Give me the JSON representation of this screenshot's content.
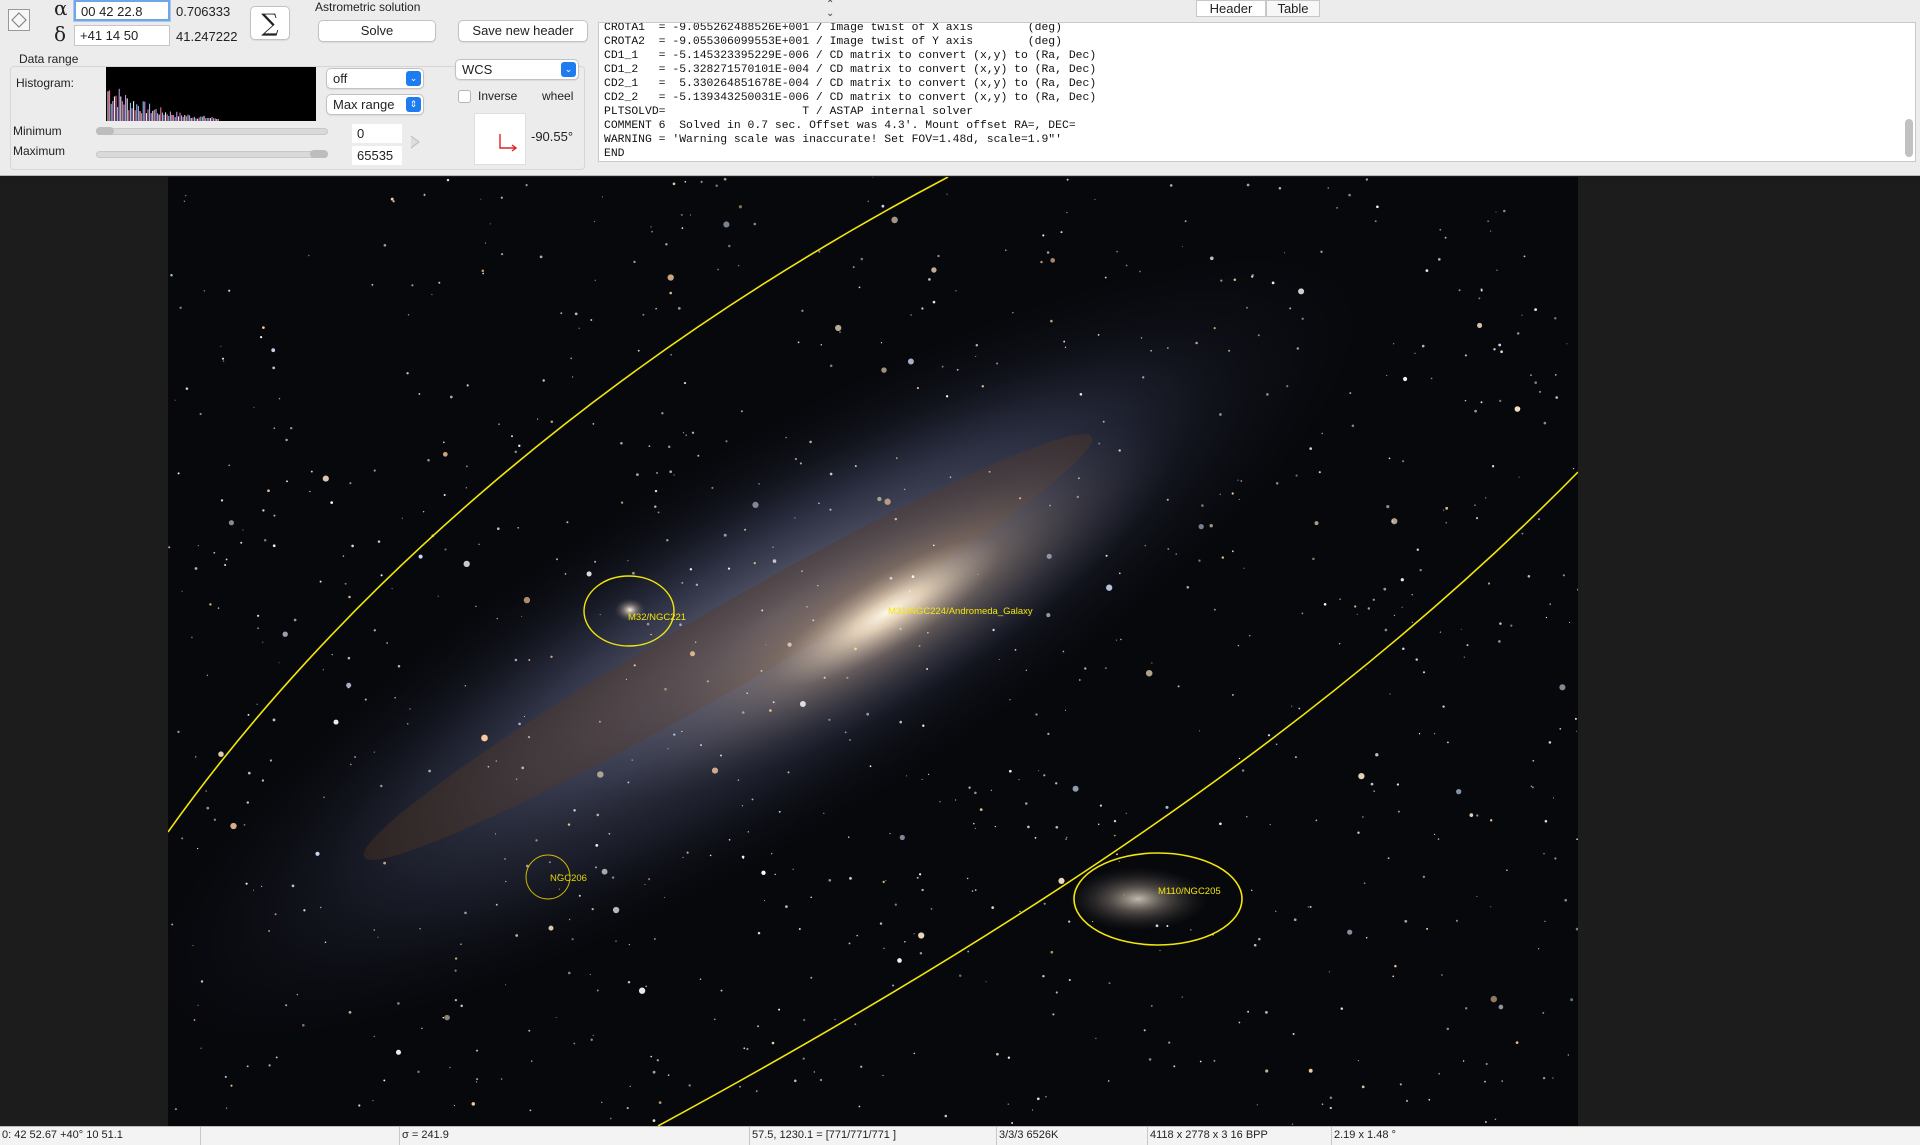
{
  "coords": {
    "alpha_symbol": "α",
    "delta_symbol": "δ",
    "ra_value": "00 42 22.8",
    "ra_decimal": "0.706333",
    "dec_value": "+41 14 50",
    "dec_decimal": "41.247222",
    "sigma_label": "∑"
  },
  "astrometric": {
    "title": "Astrometric solution",
    "solve_label": "Solve",
    "save_header_label": "Save new header"
  },
  "data_range": {
    "title": "Data range",
    "histogram_label": "Histogram:",
    "stretch_select": "off",
    "range_select": "Max range",
    "minimum_label": "Minimum",
    "maximum_label": "Maximum",
    "min_value": "0",
    "max_value": "65535",
    "min_slider_level": 0.0,
    "max_slider_level": 1.0
  },
  "overlay": {
    "grid_select": "WCS",
    "inverse_label": "Inverse",
    "wheel_label": "wheel",
    "rotation_value": "-90.55°"
  },
  "header_tabs": {
    "header": "Header",
    "table": "Table",
    "active": "Header"
  },
  "header_lines": [
    "CROTA1  = -9.055262488526E+001 / Image twist of X axis        (deg)",
    "CROTA2  = -9.055306099553E+001 / Image twist of Y axis        (deg)",
    "CD1_1   = -5.145323395229E-006 / CD matrix to convert (x,y) to (Ra, Dec)",
    "CD1_2   = -5.328271570101E-004 / CD matrix to convert (x,y) to (Ra, Dec)",
    "CD2_1   =  5.330264851678E-004 / CD matrix to convert (x,y) to (Ra, Dec)",
    "CD2_2   = -5.139343250031E-006 / CD matrix to convert (x,y) to (Ra, Dec)",
    "PLTSOLVD=                    T / ASTAP internal solver",
    "COMMENT 6  Solved in 0.7 sec. Offset was 4.3'. Mount offset RA=, DEC=",
    "WARNING = 'Warning scale was inaccurate! Set FOV=1.48d, scale=1.9\"'",
    "END"
  ],
  "annotations": [
    {
      "label": "M31/NGC224/Andromeda_Galaxy"
    },
    {
      "label": "M32/NGC221"
    },
    {
      "label": "NGC206"
    },
    {
      "label": "M110/NGC205"
    }
  ],
  "status": {
    "position": "0: 42  52.67   +40° 10  51.1",
    "sigma": "σ = 241.9",
    "pixel": "57.5, 1230.1 = [771/771/771 ]",
    "files": "3/3/3  6526K",
    "dimensions": "4118 x 2778 x 3   16 BPP",
    "fov": "2.19 x 1.48 °"
  },
  "colors": {
    "annotation": "#f2e60a",
    "focus": "#6fa6ea",
    "select_accent": "#1e7bf0",
    "rotation_arrow": "#e02020"
  }
}
